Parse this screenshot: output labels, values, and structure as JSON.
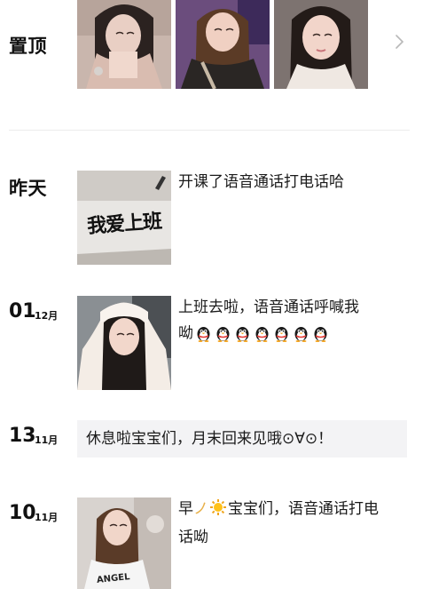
{
  "sections": {
    "pinned": {
      "label": "置顶"
    },
    "yesterday": {
      "label": "昨天",
      "text": "开课了语音通话打电话哈"
    },
    "post_0112": {
      "day": "01",
      "month": "12月",
      "text_line1": "上班去啦，语音通话呼喊我",
      "text_line2_prefix": "呦",
      "emoji_icons": [
        "penguin-icon",
        "penguin-icon",
        "penguin-icon",
        "penguin-icon",
        "penguin-icon",
        "penguin-icon",
        "penguin-icon"
      ]
    },
    "post_1311": {
      "day": "13",
      "month": "11月",
      "text": "休息啦宝宝们，月末回来见哦⊙∀⊙！"
    },
    "post_1011": {
      "day": "10",
      "month": "11月",
      "text_prefix": "早",
      "text_after_emoji": "宝宝们，语音通话打电",
      "text_line2": "话呦"
    }
  },
  "yesterday_image_text": "我爱上班",
  "shirt_text": "ANGEL",
  "colors": {
    "divider": "#ececec",
    "text_card_bg": "#f3f3f5",
    "primary_text": "#111111"
  }
}
